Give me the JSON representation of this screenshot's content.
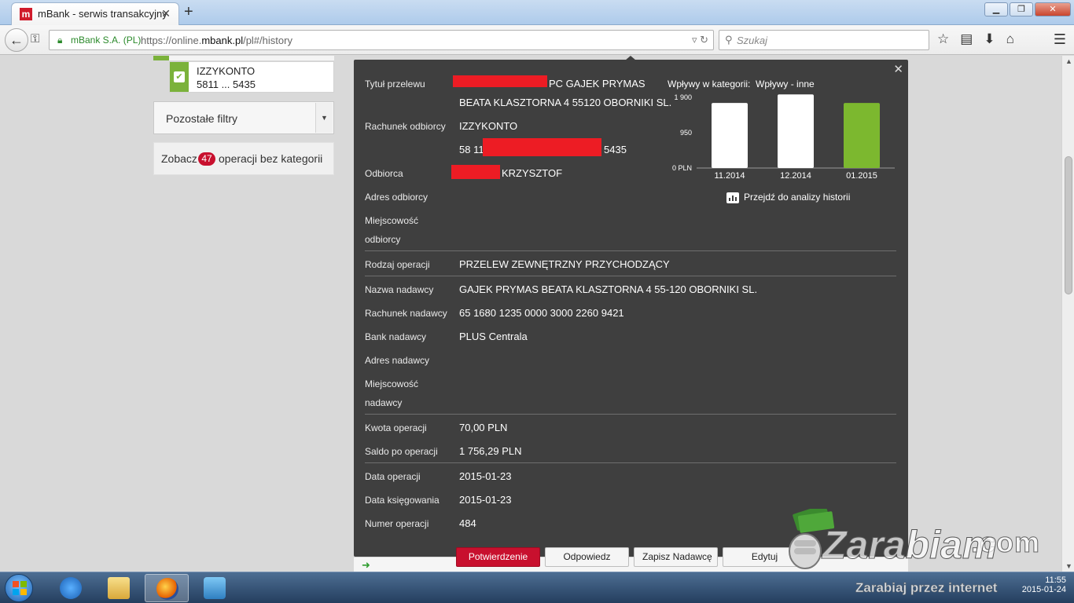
{
  "browser": {
    "tab_title": "mBank - serwis transakcyjny",
    "tab_close": "✕",
    "new_tab": "+",
    "site_identity": "mBank S.A. (PL)",
    "url_prefix": "https://online.",
    "url_domain": "mbank.pl",
    "url_path": "/pl#/history",
    "search_placeholder": "Szukaj",
    "window_buttons": [
      "▁",
      "❐",
      "✕"
    ]
  },
  "sidebar": {
    "account_name": "IZZYKONTO",
    "account_number": "5811 ... 5435",
    "filters_label": "Pozostałe filtry",
    "nocat_prefix": "Zobacz",
    "nocat_count": "47",
    "nocat_suffix": "operacji bez kategorii"
  },
  "details": {
    "close": "✕",
    "title_label": "Tytuł przelewu",
    "title_value_1": "PC GAJEK PRYMAS",
    "title_value_2": "BEATA KLASZTORNA 4 55120 OBORNIKI SL.",
    "recipient_account_label": "Rachunek odbiorcy",
    "recipient_account_name": "IZZYKONTO",
    "recipient_account_prefix": "58 11",
    "recipient_account_suffix": "5435",
    "recipient_label": "Odbiorca",
    "recipient_value": "KRZYSZTOF",
    "recipient_address_label": "Adres odbiorcy",
    "recipient_city_label_1": "Miejscowość",
    "recipient_city_label_2": "odbiorcy",
    "operation_type_label": "Rodzaj operacji",
    "operation_type_value": "PRZELEW ZEWNĘTRZNY PRZYCHODZĄCY",
    "sender_name_label": "Nazwa nadawcy",
    "sender_name_value": "GAJEK PRYMAS BEATA KLASZTORNA 4 55-120 OBORNIKI SL.",
    "sender_account_label": "Rachunek nadawcy",
    "sender_account_value": "65 1680 1235 0000 3000 2260 9421",
    "sender_bank_label": "Bank nadawcy",
    "sender_bank_value": "PLUS Centrala",
    "sender_address_label": "Adres nadawcy",
    "sender_city_label_1": "Miejscowość",
    "sender_city_label_2": "nadawcy",
    "amount_label": "Kwota operacji",
    "amount_value": "70,00 PLN",
    "balance_label": "Saldo po operacji",
    "balance_value": "1 756,29 PLN",
    "op_date_label": "Data operacji",
    "op_date_value": "2015-01-23",
    "book_date_label": "Data księgowania",
    "book_date_value": "2015-01-23",
    "op_number_label": "Numer operacji",
    "op_number_value": "484",
    "analysis_link": "Przejdź do analizy historii"
  },
  "actions": {
    "confirm": "Potwierdzenie",
    "reply": "Odpowiedz",
    "save_sender": "Zapisz Nadawcę",
    "edit": "Edytuj"
  },
  "chart_data": {
    "type": "bar",
    "title": "Wpływy w kategorii:",
    "category_name": "Wpływy - inne",
    "categories": [
      "11.2014",
      "12.2014",
      "01.2015"
    ],
    "values": [
      1750,
      1980,
      1750
    ],
    "y_ticks": [
      "0 PLN",
      "950",
      "1 900"
    ],
    "ylim": [
      0,
      1900
    ],
    "colors": [
      "#ffffff",
      "#ffffff",
      "#7cb82f"
    ]
  },
  "watermark": {
    "com": ".com",
    "main": "Zarabiam",
    "sub": "Zarabiaj przez internet"
  },
  "taskbar": {
    "time": "11:55",
    "date": "2015-01-24"
  },
  "colors": {
    "brand_red": "#c8102e",
    "panel_bg": "#3f3f3f",
    "account_green": "#7bb23b"
  }
}
